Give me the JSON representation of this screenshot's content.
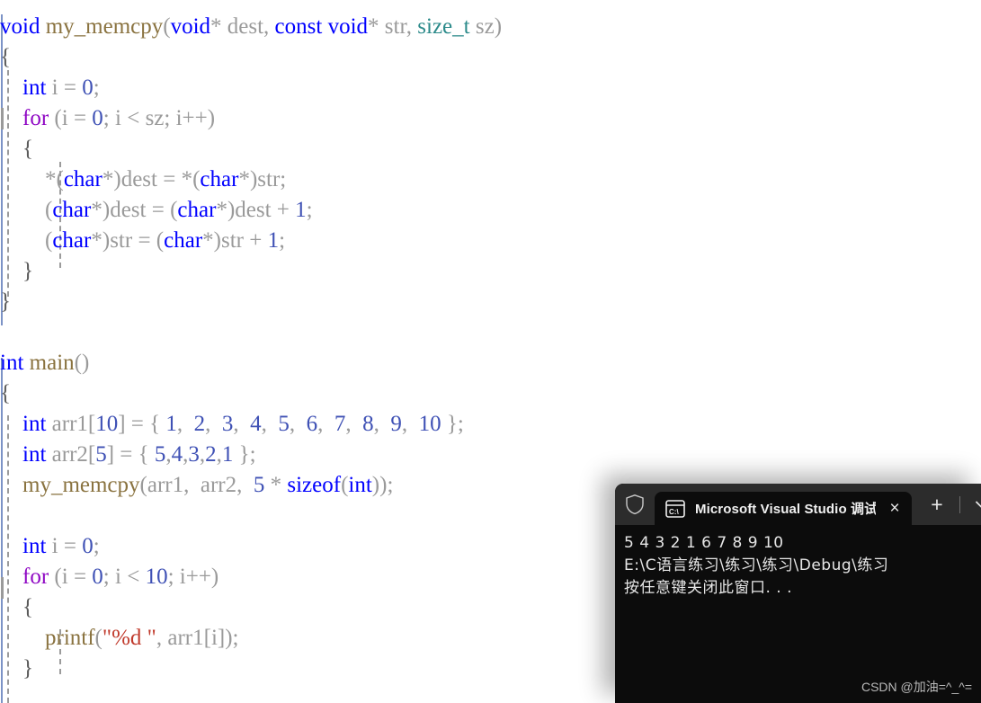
{
  "editor": {
    "language": "C",
    "background": "#ffffff",
    "font_size_px": 25,
    "colors": {
      "keyword": "#0000ff",
      "keyword_control": "#8f08c4",
      "type": "#2b8a8a",
      "function": "#8a7340",
      "identifier": "#9a9a9a",
      "number": "#3f51b5",
      "string": "#c0392b",
      "brace": "#5a5a5a",
      "indent_guide": "#9b9b9b"
    },
    "lines": [
      {
        "indent": 0,
        "tokens": [
          {
            "t": "void",
            "c": "kw"
          },
          {
            "t": " ",
            "c": "punc"
          },
          {
            "t": "my_memcpy",
            "c": "fn"
          },
          {
            "t": "(",
            "c": "punc"
          },
          {
            "t": "void",
            "c": "kw"
          },
          {
            "t": "*",
            "c": "punc"
          },
          {
            "t": " ",
            "c": "punc"
          },
          {
            "t": "dest",
            "c": "id"
          },
          {
            "t": ", ",
            "c": "punc"
          },
          {
            "t": "const",
            "c": "kw"
          },
          {
            "t": " ",
            "c": "punc"
          },
          {
            "t": "void",
            "c": "kw"
          },
          {
            "t": "*",
            "c": "punc"
          },
          {
            "t": " ",
            "c": "punc"
          },
          {
            "t": "str",
            "c": "id"
          },
          {
            "t": ", ",
            "c": "punc"
          },
          {
            "t": "size_t",
            "c": "type"
          },
          {
            "t": " ",
            "c": "punc"
          },
          {
            "t": "sz",
            "c": "id"
          },
          {
            "t": ")",
            "c": "punc"
          }
        ]
      },
      {
        "indent": 0,
        "tokens": [
          {
            "t": "{",
            "c": "brc"
          }
        ]
      },
      {
        "indent": 0,
        "tokens": [
          {
            "t": "    ",
            "c": "punc"
          },
          {
            "t": "int",
            "c": "kw"
          },
          {
            "t": " ",
            "c": "punc"
          },
          {
            "t": "i",
            "c": "id"
          },
          {
            "t": " = ",
            "c": "punc"
          },
          {
            "t": "0",
            "c": "num"
          },
          {
            "t": ";",
            "c": "punc"
          }
        ]
      },
      {
        "indent": 0,
        "tokens": [
          {
            "t": "    ",
            "c": "punc"
          },
          {
            "t": "for",
            "c": "kw2"
          },
          {
            "t": " (",
            "c": "punc"
          },
          {
            "t": "i",
            "c": "id"
          },
          {
            "t": " = ",
            "c": "punc"
          },
          {
            "t": "0",
            "c": "num"
          },
          {
            "t": "; ",
            "c": "punc"
          },
          {
            "t": "i",
            "c": "id"
          },
          {
            "t": " < ",
            "c": "punc"
          },
          {
            "t": "sz",
            "c": "id"
          },
          {
            "t": "; ",
            "c": "punc"
          },
          {
            "t": "i",
            "c": "id"
          },
          {
            "t": "++)",
            "c": "punc"
          }
        ]
      },
      {
        "indent": 0,
        "tokens": [
          {
            "t": "    ",
            "c": "punc"
          },
          {
            "t": "{",
            "c": "brc"
          }
        ]
      },
      {
        "indent": 0,
        "tokens": [
          {
            "t": "        ",
            "c": "punc"
          },
          {
            "t": "*(",
            "c": "punc"
          },
          {
            "t": "char",
            "c": "kw"
          },
          {
            "t": "*)",
            "c": "punc"
          },
          {
            "t": "dest",
            "c": "id"
          },
          {
            "t": " = ",
            "c": "punc"
          },
          {
            "t": "*(",
            "c": "punc"
          },
          {
            "t": "char",
            "c": "kw"
          },
          {
            "t": "*)",
            "c": "punc"
          },
          {
            "t": "str",
            "c": "id"
          },
          {
            "t": ";",
            "c": "punc"
          }
        ]
      },
      {
        "indent": 0,
        "tokens": [
          {
            "t": "        ",
            "c": "punc"
          },
          {
            "t": "(",
            "c": "punc"
          },
          {
            "t": "char",
            "c": "kw"
          },
          {
            "t": "*)",
            "c": "punc"
          },
          {
            "t": "dest",
            "c": "id"
          },
          {
            "t": " = ",
            "c": "punc"
          },
          {
            "t": "(",
            "c": "punc"
          },
          {
            "t": "char",
            "c": "kw"
          },
          {
            "t": "*)",
            "c": "punc"
          },
          {
            "t": "dest",
            "c": "id"
          },
          {
            "t": " + ",
            "c": "punc"
          },
          {
            "t": "1",
            "c": "num"
          },
          {
            "t": ";",
            "c": "punc"
          }
        ]
      },
      {
        "indent": 0,
        "tokens": [
          {
            "t": "        ",
            "c": "punc"
          },
          {
            "t": "(",
            "c": "punc"
          },
          {
            "t": "char",
            "c": "kw"
          },
          {
            "t": "*)",
            "c": "punc"
          },
          {
            "t": "str",
            "c": "id"
          },
          {
            "t": " = ",
            "c": "punc"
          },
          {
            "t": "(",
            "c": "punc"
          },
          {
            "t": "char",
            "c": "kw"
          },
          {
            "t": "*)",
            "c": "punc"
          },
          {
            "t": "str",
            "c": "id"
          },
          {
            "t": " + ",
            "c": "punc"
          },
          {
            "t": "1",
            "c": "num"
          },
          {
            "t": ";",
            "c": "punc"
          }
        ]
      },
      {
        "indent": 0,
        "tokens": [
          {
            "t": "    ",
            "c": "punc"
          },
          {
            "t": "}",
            "c": "brc"
          }
        ]
      },
      {
        "indent": 0,
        "tokens": [
          {
            "t": "}",
            "c": "brc"
          }
        ]
      },
      {
        "indent": 0,
        "tokens": []
      },
      {
        "indent": 0,
        "tokens": [
          {
            "t": "int",
            "c": "kw"
          },
          {
            "t": " ",
            "c": "punc"
          },
          {
            "t": "main",
            "c": "fn"
          },
          {
            "t": "()",
            "c": "punc"
          }
        ]
      },
      {
        "indent": 0,
        "tokens": [
          {
            "t": "{",
            "c": "brc"
          }
        ]
      },
      {
        "indent": 0,
        "tokens": [
          {
            "t": "    ",
            "c": "punc"
          },
          {
            "t": "int",
            "c": "kw"
          },
          {
            "t": " ",
            "c": "punc"
          },
          {
            "t": "arr1",
            "c": "id"
          },
          {
            "t": "[",
            "c": "punc"
          },
          {
            "t": "10",
            "c": "num"
          },
          {
            "t": "] = { ",
            "c": "punc"
          },
          {
            "t": "1",
            "c": "num"
          },
          {
            "t": ",  ",
            "c": "punc"
          },
          {
            "t": "2",
            "c": "num"
          },
          {
            "t": ",  ",
            "c": "punc"
          },
          {
            "t": "3",
            "c": "num"
          },
          {
            "t": ",  ",
            "c": "punc"
          },
          {
            "t": "4",
            "c": "num"
          },
          {
            "t": ",  ",
            "c": "punc"
          },
          {
            "t": "5",
            "c": "num"
          },
          {
            "t": ",  ",
            "c": "punc"
          },
          {
            "t": "6",
            "c": "num"
          },
          {
            "t": ",  ",
            "c": "punc"
          },
          {
            "t": "7",
            "c": "num"
          },
          {
            "t": ",  ",
            "c": "punc"
          },
          {
            "t": "8",
            "c": "num"
          },
          {
            "t": ",  ",
            "c": "punc"
          },
          {
            "t": "9",
            "c": "num"
          },
          {
            "t": ",  ",
            "c": "punc"
          },
          {
            "t": "10",
            "c": "num"
          },
          {
            "t": " };",
            "c": "punc"
          }
        ]
      },
      {
        "indent": 0,
        "tokens": [
          {
            "t": "    ",
            "c": "punc"
          },
          {
            "t": "int",
            "c": "kw"
          },
          {
            "t": " ",
            "c": "punc"
          },
          {
            "t": "arr2",
            "c": "id"
          },
          {
            "t": "[",
            "c": "punc"
          },
          {
            "t": "5",
            "c": "num"
          },
          {
            "t": "] = { ",
            "c": "punc"
          },
          {
            "t": "5",
            "c": "num"
          },
          {
            "t": ",",
            "c": "punc"
          },
          {
            "t": "4",
            "c": "num"
          },
          {
            "t": ",",
            "c": "punc"
          },
          {
            "t": "3",
            "c": "num"
          },
          {
            "t": ",",
            "c": "punc"
          },
          {
            "t": "2",
            "c": "num"
          },
          {
            "t": ",",
            "c": "punc"
          },
          {
            "t": "1",
            "c": "num"
          },
          {
            "t": " };",
            "c": "punc"
          }
        ]
      },
      {
        "indent": 0,
        "tokens": [
          {
            "t": "    ",
            "c": "punc"
          },
          {
            "t": "my_memcpy",
            "c": "fn"
          },
          {
            "t": "(",
            "c": "punc"
          },
          {
            "t": "arr1",
            "c": "id"
          },
          {
            "t": ",  ",
            "c": "punc"
          },
          {
            "t": "arr2",
            "c": "id"
          },
          {
            "t": ",  ",
            "c": "punc"
          },
          {
            "t": "5",
            "c": "num"
          },
          {
            "t": " * ",
            "c": "punc"
          },
          {
            "t": "sizeof",
            "c": "kw"
          },
          {
            "t": "(",
            "c": "punc"
          },
          {
            "t": "int",
            "c": "kw"
          },
          {
            "t": "));",
            "c": "punc"
          }
        ]
      },
      {
        "indent": 0,
        "tokens": []
      },
      {
        "indent": 0,
        "tokens": [
          {
            "t": "    ",
            "c": "punc"
          },
          {
            "t": "int",
            "c": "kw"
          },
          {
            "t": " ",
            "c": "punc"
          },
          {
            "t": "i",
            "c": "id"
          },
          {
            "t": " = ",
            "c": "punc"
          },
          {
            "t": "0",
            "c": "num"
          },
          {
            "t": ";",
            "c": "punc"
          }
        ]
      },
      {
        "indent": 0,
        "tokens": [
          {
            "t": "    ",
            "c": "punc"
          },
          {
            "t": "for",
            "c": "kw2"
          },
          {
            "t": " (",
            "c": "punc"
          },
          {
            "t": "i",
            "c": "id"
          },
          {
            "t": " = ",
            "c": "punc"
          },
          {
            "t": "0",
            "c": "num"
          },
          {
            "t": "; ",
            "c": "punc"
          },
          {
            "t": "i",
            "c": "id"
          },
          {
            "t": " < ",
            "c": "punc"
          },
          {
            "t": "10",
            "c": "num"
          },
          {
            "t": "; ",
            "c": "punc"
          },
          {
            "t": "i",
            "c": "id"
          },
          {
            "t": "++)",
            "c": "punc"
          }
        ]
      },
      {
        "indent": 0,
        "tokens": [
          {
            "t": "    ",
            "c": "punc"
          },
          {
            "t": "{",
            "c": "brc"
          }
        ]
      },
      {
        "indent": 0,
        "tokens": [
          {
            "t": "        ",
            "c": "punc"
          },
          {
            "t": "printf",
            "c": "fn"
          },
          {
            "t": "(",
            "c": "punc"
          },
          {
            "t": "\"%d \"",
            "c": "str"
          },
          {
            "t": ", ",
            "c": "punc"
          },
          {
            "t": "arr1",
            "c": "id"
          },
          {
            "t": "[",
            "c": "punc"
          },
          {
            "t": "i",
            "c": "id"
          },
          {
            "t": "]);",
            "c": "punc"
          }
        ]
      },
      {
        "indent": 0,
        "tokens": [
          {
            "t": "    ",
            "c": "punc"
          },
          {
            "t": "}",
            "c": "brc"
          }
        ]
      }
    ]
  },
  "console": {
    "window_title": "Microsoft Visual Studio 调试控",
    "icons": {
      "shield": "shield-icon",
      "tab": "console-cmd-icon",
      "close": "×",
      "new_tab": "+",
      "chevron": "chevron-down-icon"
    },
    "background": "#0c0c0c",
    "titlebar_background": "#2c2c2c",
    "output": [
      "5 4 3 2 1 6 7 8 9 10",
      "E:\\C语言练习\\练习\\练习\\Debug\\练习",
      "按任意键关闭此窗口. . ."
    ],
    "watermark": "CSDN @加油=^_^="
  }
}
